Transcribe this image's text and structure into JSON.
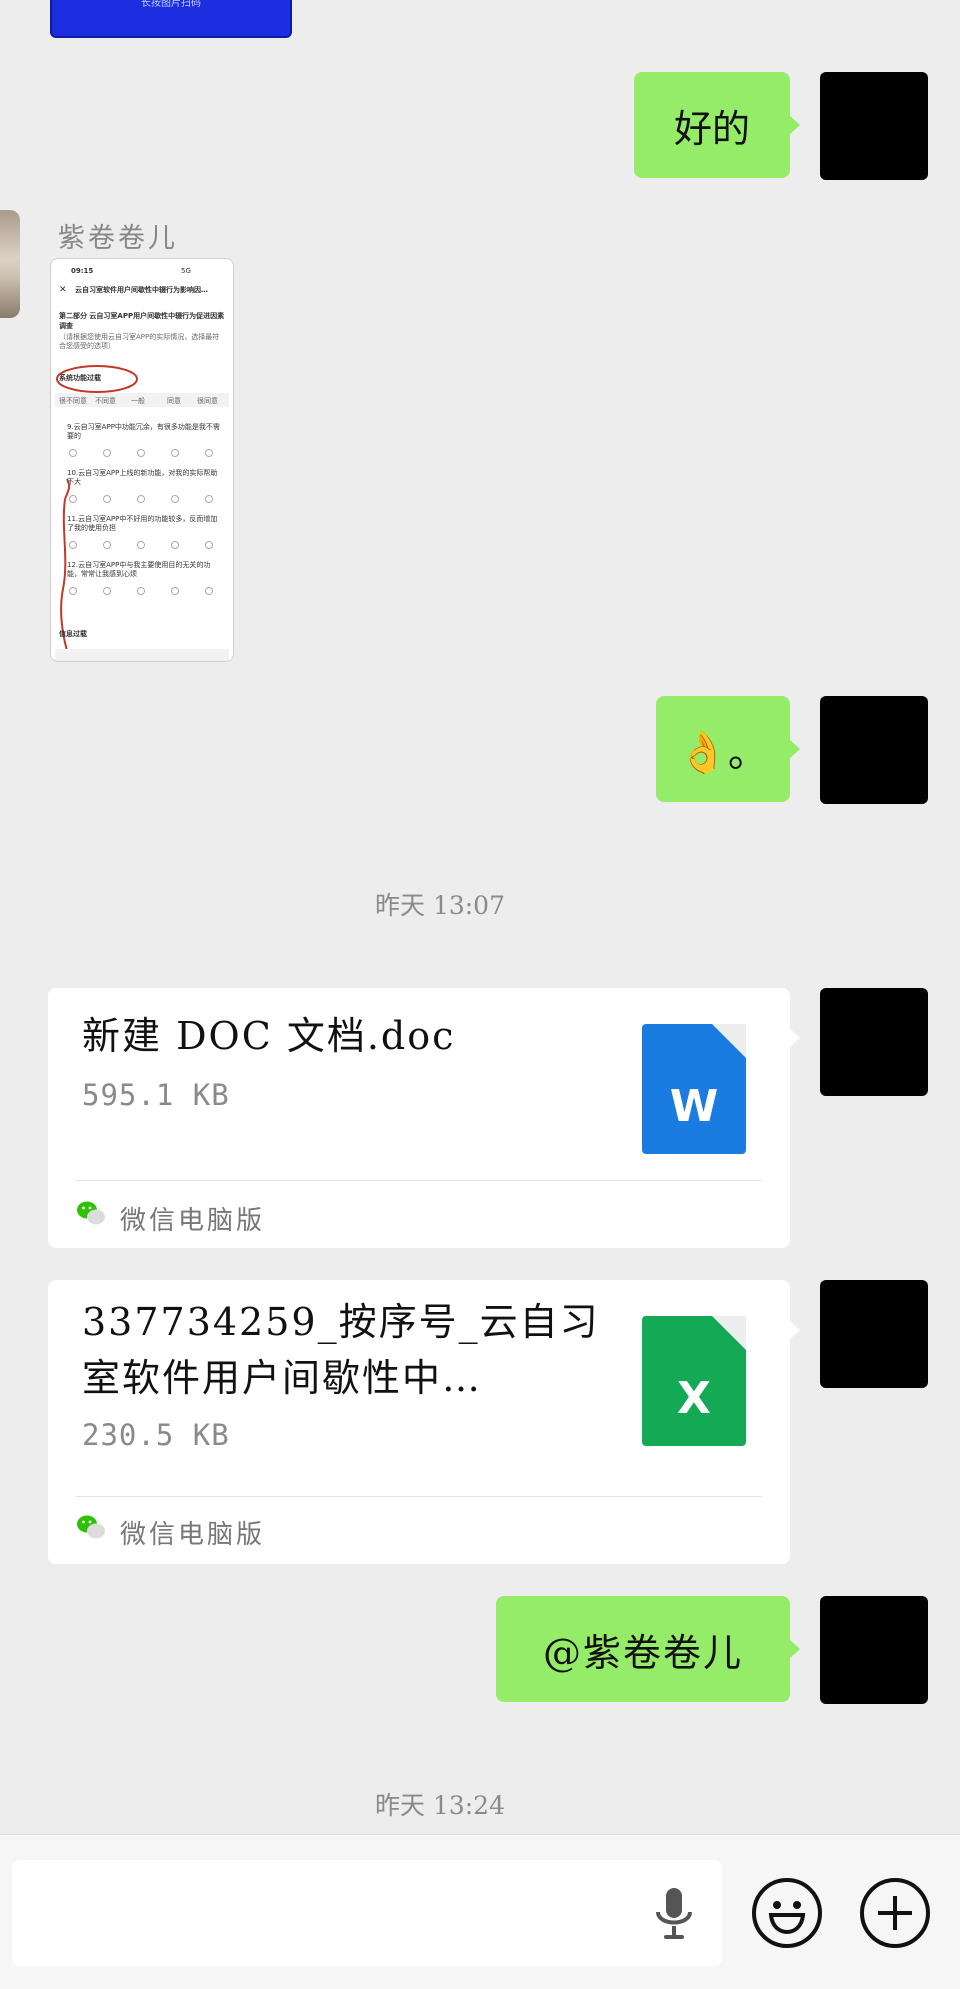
{
  "top_card": {
    "caption": "长按图片扫码"
  },
  "messages": {
    "reply_ok": "好的",
    "sender_name": "紫卷卷儿",
    "ok_emoji": "👌。",
    "mention": "@紫卷卷儿"
  },
  "screenshot": {
    "time": "09:15",
    "signal": "5G",
    "header_title": "云自习室软件用户间歇性中辍行为影响因…",
    "section_title": "第二部分 云自习室APP用户间歇性中辍行为促进因素调查",
    "section_note": "（请根据您使用云自习室APP的实际情况，选择最符合您感受的选项）",
    "group1": "系统功能过载",
    "scale": [
      "很不同意",
      "不同意",
      "一般",
      "同意",
      "很同意"
    ],
    "questions": [
      "9.云自习室APP中功能冗余，有很多功能是我不需要的",
      "10.云自习室APP上线的新功能，对我的实际帮助不大",
      "11.云自习室APP中不好用的功能较多，反而增加了我的使用负担",
      "12.云自习室APP中与我主要使用目的无关的功能，常常让我感到心烦"
    ],
    "group2": "信息过载"
  },
  "timestamps": {
    "t1": "昨天 13:07",
    "t2": "昨天 13:24"
  },
  "files": [
    {
      "name_line1": "新建 DOC 文档.doc",
      "name_line2": "",
      "size": "595.1 KB",
      "type_letter": "W",
      "type_color": "#1a7be0",
      "source": "微信电脑版"
    },
    {
      "name_line1": "337734259_按序号_云自习",
      "name_line2": "室软件用户间歇性中…",
      "size": "230.5 KB",
      "type_letter": "X",
      "type_color": "#14aa55",
      "source": "微信电脑版"
    }
  ],
  "input_bar": {
    "value": "",
    "icons": [
      "microphone-icon",
      "emoji-icon",
      "add-icon"
    ]
  }
}
